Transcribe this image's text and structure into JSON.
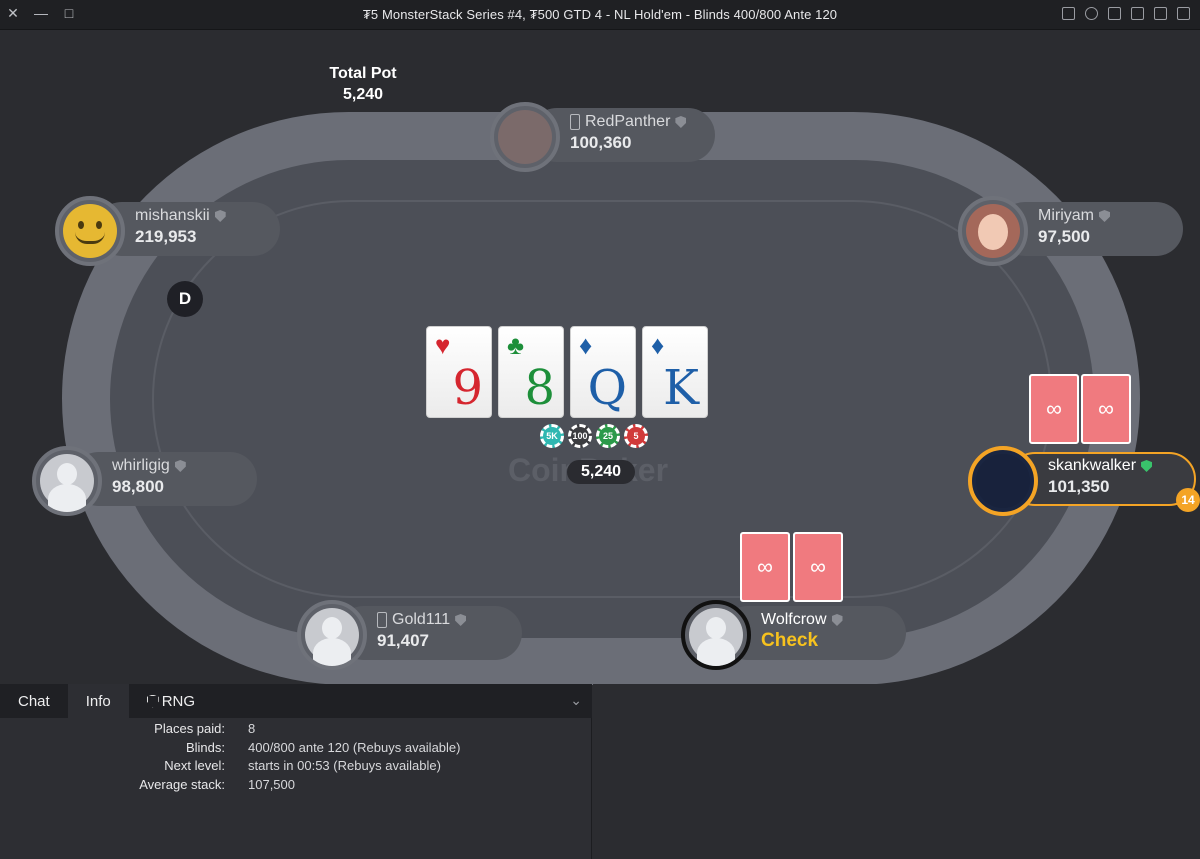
{
  "window": {
    "title": "₮5 MonsterStack Series #4, ₮500 GTD 4 - NL Hold'em - Blinds 400/800 Ante 120"
  },
  "table": {
    "total_pot_label": "Total Pot",
    "total_pot_value": "5,240",
    "dealer_label": "D",
    "pot_amount": "5,240",
    "watermark": "CoinPoker",
    "timer_badge": "14"
  },
  "board": [
    {
      "rank": "9",
      "suit": "♥",
      "color": "#d5262f"
    },
    {
      "rank": "8",
      "suit": "♣",
      "color": "#1d8f3a"
    },
    {
      "rank": "Q",
      "suit": "♦",
      "color": "#1e5fa8"
    },
    {
      "rank": "K",
      "suit": "♦",
      "color": "#1e5fa8"
    }
  ],
  "chips": [
    {
      "label": "5K",
      "color": "#2fb7b1"
    },
    {
      "label": "100",
      "color": "#3b3c40"
    },
    {
      "label": "25",
      "color": "#2c9a4a"
    },
    {
      "label": "5",
      "color": "#d13a3a"
    }
  ],
  "players": {
    "redpanther": {
      "name": "RedPanther",
      "stack": "100,360"
    },
    "mishanskii": {
      "name": "mishanskii",
      "stack": "219,953"
    },
    "miriyam": {
      "name": "Miriyam",
      "stack": "97,500"
    },
    "whirligig": {
      "name": "whirligig",
      "stack": "98,800"
    },
    "skankwalker": {
      "name": "skankwalker",
      "stack": "101,350"
    },
    "gold111": {
      "name": "Gold111",
      "stack": "91,407"
    },
    "wolfcrow": {
      "name": "Wolfcrow",
      "action": "Check"
    }
  },
  "panel": {
    "tabs": [
      "Chat",
      "Info",
      "RNG"
    ],
    "active_tab": "Info",
    "rows": [
      {
        "k": "Places paid:",
        "v": "8"
      },
      {
        "k": "Blinds:",
        "v": "400/800 ante 120 (Rebuys available)"
      },
      {
        "k": "Next level:",
        "v": "starts in 00:53 (Rebuys available)"
      },
      {
        "k": "Average stack:",
        "v": "107,500"
      }
    ]
  }
}
